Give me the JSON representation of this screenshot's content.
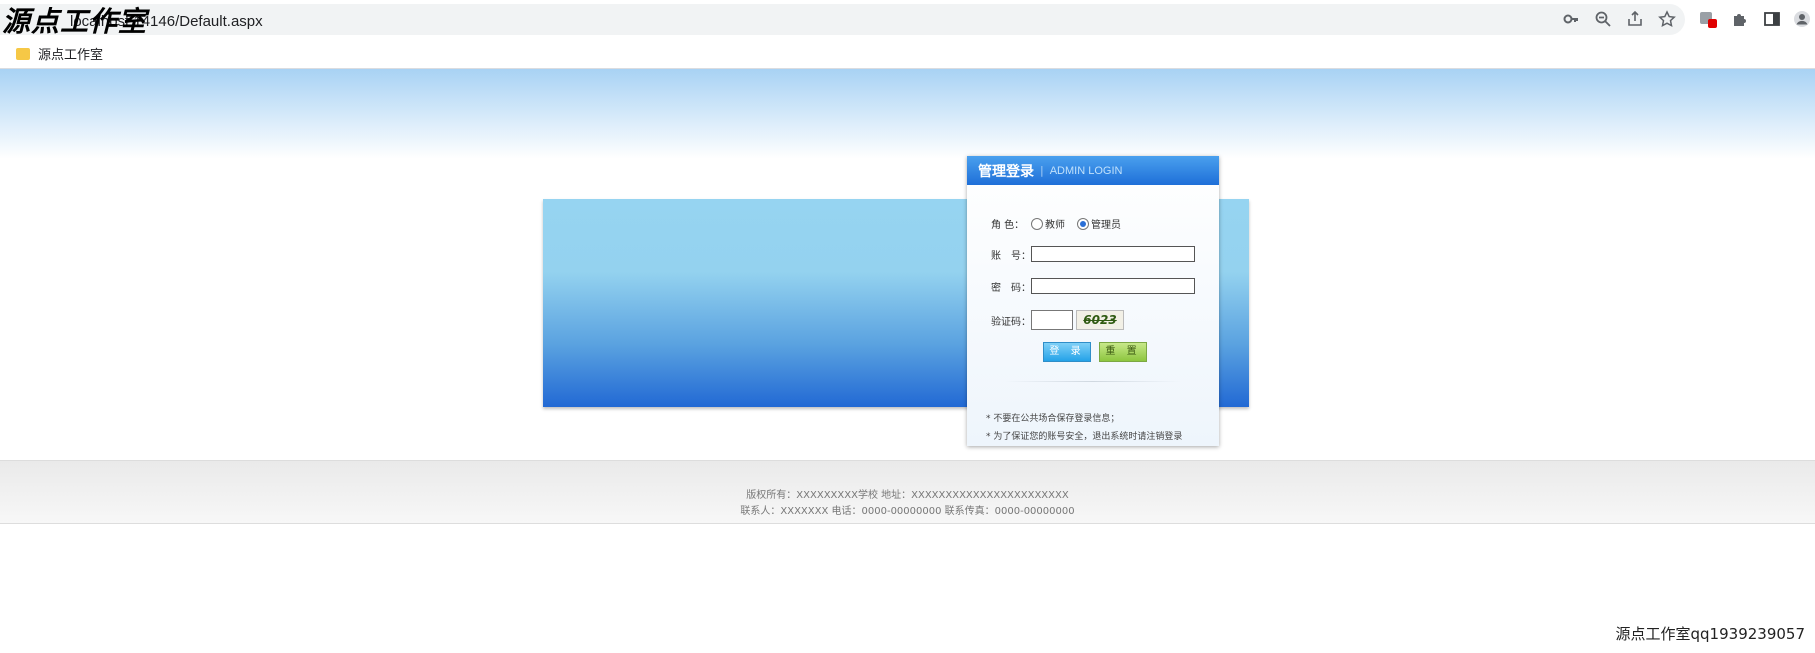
{
  "browser": {
    "url": "localhost:14146/Default.aspx",
    "bookmark": "源点工作室"
  },
  "watermark": {
    "top": "源点工作室",
    "bottom": "源点工作室qq1939239057"
  },
  "login": {
    "title": "管理登录",
    "divider": "|",
    "subtitle": "ADMIN LOGIN",
    "role_label": "角 色：",
    "role_options": [
      "教师",
      "管理员"
    ],
    "role_selected": "管理员",
    "account_label": "账　号：",
    "account_value": "",
    "password_label": "密　码：",
    "password_value": "",
    "captcha_label": "验证码：",
    "captcha_value": "",
    "captcha_image_text": "6023",
    "login_button": "登 录",
    "reset_button": "重 置",
    "tips": [
      "* 不要在公共场合保存登录信息；",
      "* 为了保证您的账号安全，退出系统时请注销登录"
    ]
  },
  "footer": {
    "line1": "版权所有：XXXXXXXXX学校 地址：XXXXXXXXXXXXXXXXXXXXXXX",
    "line2": "联系人：XXXXXXX 电话：0000-00000000 联系传真：0000-00000000"
  }
}
